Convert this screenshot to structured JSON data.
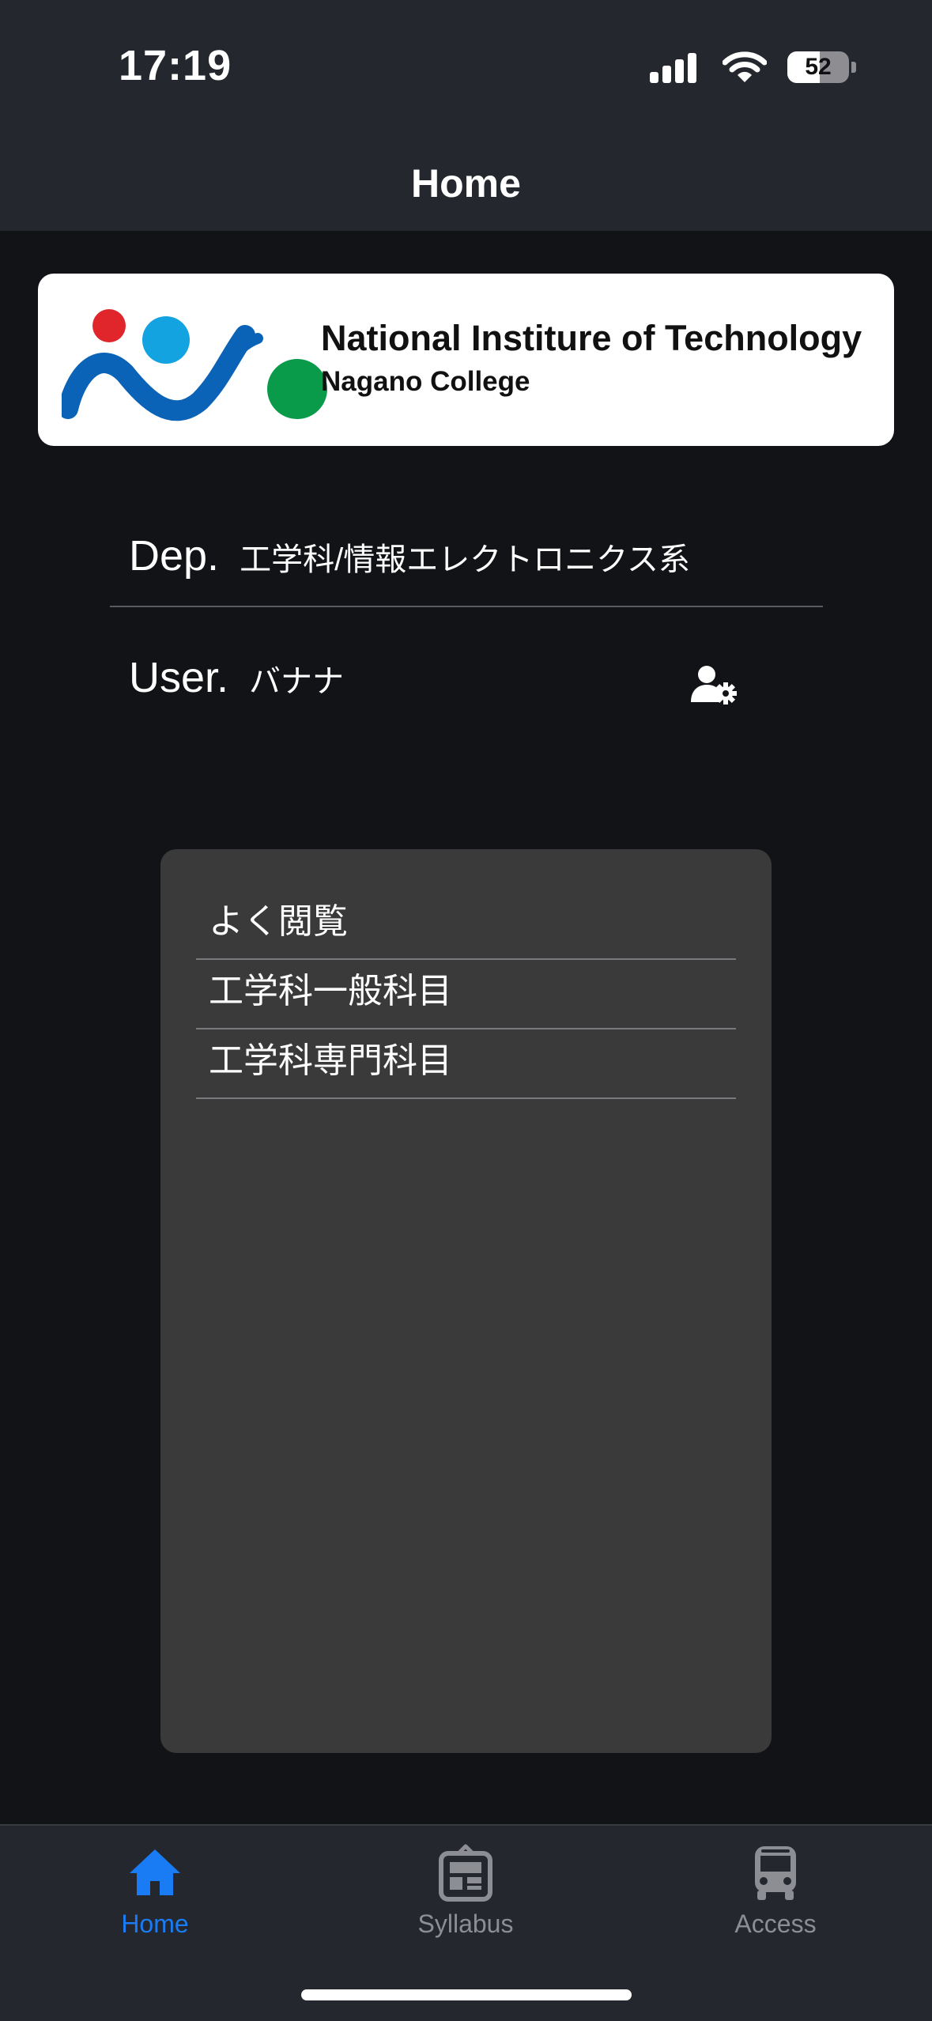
{
  "status_bar": {
    "time": "17:19",
    "battery_level": "52",
    "icons": [
      "cellular-signal-icon",
      "wifi-icon",
      "battery-icon"
    ]
  },
  "header": {
    "title": "Home"
  },
  "banner": {
    "logo_icon": "nagano-college-logo",
    "title": "National Institure of Technology",
    "subtitle": "Nagano College"
  },
  "profile": {
    "dep_label": "Dep.",
    "dep_value": "工学科/情報エレクトロニクス系",
    "user_label": "User.",
    "user_value": "バナナ",
    "settings_icon": "user-settings-icon"
  },
  "menu": {
    "items": [
      {
        "label": "よく閲覧"
      },
      {
        "label": "工学科一般科目"
      },
      {
        "label": "工学科専門科目"
      }
    ]
  },
  "tab_bar": {
    "tabs": [
      {
        "label": "Home",
        "icon": "home-icon",
        "active": true
      },
      {
        "label": "Syllabus",
        "icon": "syllabus-icon",
        "active": false
      },
      {
        "label": "Access",
        "icon": "bus-icon",
        "active": false
      }
    ]
  },
  "colors": {
    "background": "#121316",
    "bar": "#24272d",
    "panel": "#3a3a3b",
    "accent": "#1a7cf5",
    "inactive": "#8d8e93"
  }
}
